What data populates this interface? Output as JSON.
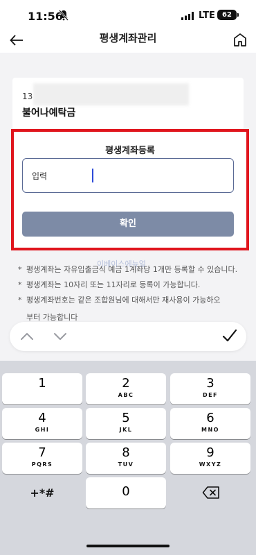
{
  "status_bar": {
    "time": "11:56",
    "network": "LTE",
    "battery": "62"
  },
  "header": {
    "title": "평생계좌관리"
  },
  "account": {
    "number_prefix": "13",
    "name": "불어나예탁금"
  },
  "register": {
    "title": "평생계좌등록",
    "input_label": "입력",
    "confirm_label": "확인"
  },
  "watermark": "이베이스에뉴얼",
  "notes": [
    "평생계좌는 자유입출금식 예금 1계좌당 1개만 등록할 수 있습니다.",
    "평생계좌는 10자리 또는 11자리로 등록이 가능합니다.",
    "평생계좌번호는 같은 조합원님에 대해서만 재사용이 가능하오",
    "부터 가능합니다"
  ],
  "note_bullet": "*",
  "keypad": {
    "keys": [
      {
        "digit": "1",
        "letters": ""
      },
      {
        "digit": "2",
        "letters": "ABC"
      },
      {
        "digit": "3",
        "letters": "DEF"
      },
      {
        "digit": "4",
        "letters": "GHI"
      },
      {
        "digit": "5",
        "letters": "JKL"
      },
      {
        "digit": "6",
        "letters": "MNO"
      },
      {
        "digit": "7",
        "letters": "PQRS"
      },
      {
        "digit": "8",
        "letters": "TUV"
      },
      {
        "digit": "9",
        "letters": "WXYZ"
      }
    ],
    "symbols": "+*#",
    "zero": "0"
  },
  "icons": {
    "back": "back-arrow-icon",
    "home": "home-icon",
    "up": "chevron-up-icon",
    "down": "chevron-down-icon",
    "done": "checkmark-icon",
    "delete": "backspace-icon"
  },
  "colors": {
    "accent": "#5a6a95",
    "highlight_border": "#e0151d",
    "button": "#7d8ba6"
  }
}
